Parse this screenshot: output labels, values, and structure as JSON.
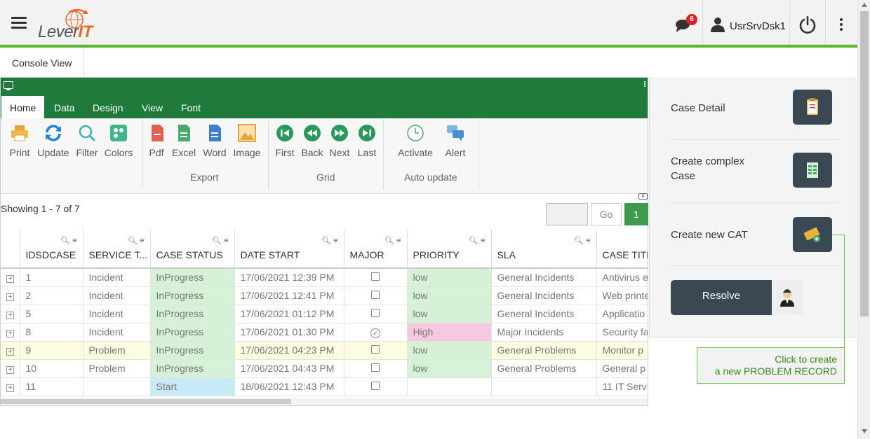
{
  "header": {
    "logo_text_a": "Lever",
    "logo_text_b": "IT",
    "notification_count": "6",
    "user_name": "UsrSrvDsk1"
  },
  "tabs": {
    "console": "Console View"
  },
  "ribbon": {
    "tabs": [
      "Home",
      "Data",
      "Design",
      "View",
      "Font"
    ],
    "buttons": {
      "print": "Print",
      "update": "Update",
      "filter": "Filter",
      "colors": "Colors",
      "pdf": "Pdf",
      "excel": "Excel",
      "word": "Word",
      "image": "Image",
      "first": "First",
      "back": "Back",
      "next": "Next",
      "last": "Last",
      "activate": "Activate",
      "alert": "Alert"
    },
    "groups": {
      "export": "Export",
      "grid": "Grid",
      "auto_update": "Auto update"
    }
  },
  "grid_toolbar": {
    "showing": "Showing 1 - 7 of 7",
    "go": "Go",
    "page": "1"
  },
  "grid": {
    "columns": [
      "IDSDCASE",
      "SERVICE T...",
      "CASE STATUS",
      "DATE START",
      "MAJOR",
      "PRIORITY",
      "SLA",
      "CASE TITLE"
    ],
    "rows": [
      {
        "id": "1",
        "service": "Incident",
        "status": "InProgress",
        "date": "17/06/2021 12:39 PM",
        "major": "box",
        "priority": "low",
        "sla": "General Incidents",
        "title": "Antivirus e"
      },
      {
        "id": "2",
        "service": "Incident",
        "status": "InProgress",
        "date": "17/06/2021 12:41 PM",
        "major": "box",
        "priority": "low",
        "sla": "General Incidents",
        "title": "Web printe"
      },
      {
        "id": "5",
        "service": "Incident",
        "status": "InProgress",
        "date": "17/06/2021 01:12 PM",
        "major": "box",
        "priority": "low",
        "sla": "General Incidents",
        "title": "Applicatio"
      },
      {
        "id": "8",
        "service": "Incident",
        "status": "InProgress",
        "date": "17/06/2021 01:30 PM",
        "major": "check",
        "priority": "High",
        "sla": "Major Incidents",
        "title": "Security fa"
      },
      {
        "id": "9",
        "service": "Problem",
        "status": "InProgress",
        "date": "17/06/2021 04:23 PM",
        "major": "box",
        "priority": "low",
        "sla": "General Problems",
        "title": "Monitor p"
      },
      {
        "id": "10",
        "service": "Problem",
        "status": "InProgress",
        "date": "17/06/2021 04:43 PM",
        "major": "box",
        "priority": "low",
        "sla": "General Problems",
        "title": "General p"
      },
      {
        "id": "11",
        "service": "",
        "status": "Start",
        "date": "18/06/2021 12:43 PM",
        "major": "box",
        "priority": "",
        "sla": "",
        "title": "11 IT Serv"
      }
    ]
  },
  "actions": {
    "case_detail": "Case Detail",
    "create_complex_1": "Create complex",
    "create_complex_2": "Case",
    "create_cat": "Create new CAT",
    "resolve": "Resolve"
  },
  "tooltip": {
    "line1": "Click to create",
    "line2": "a new PROBLEM RECORD"
  },
  "colors": {
    "brand_green": "#1e7b3c",
    "accent_green": "#5cba2c",
    "status_green": "#d6f2d6",
    "priority_high": "#f6c9e1",
    "status_start": "#c8eaf7",
    "highlight_row": "#fdfbe0",
    "button_dark": "#3a4853"
  }
}
